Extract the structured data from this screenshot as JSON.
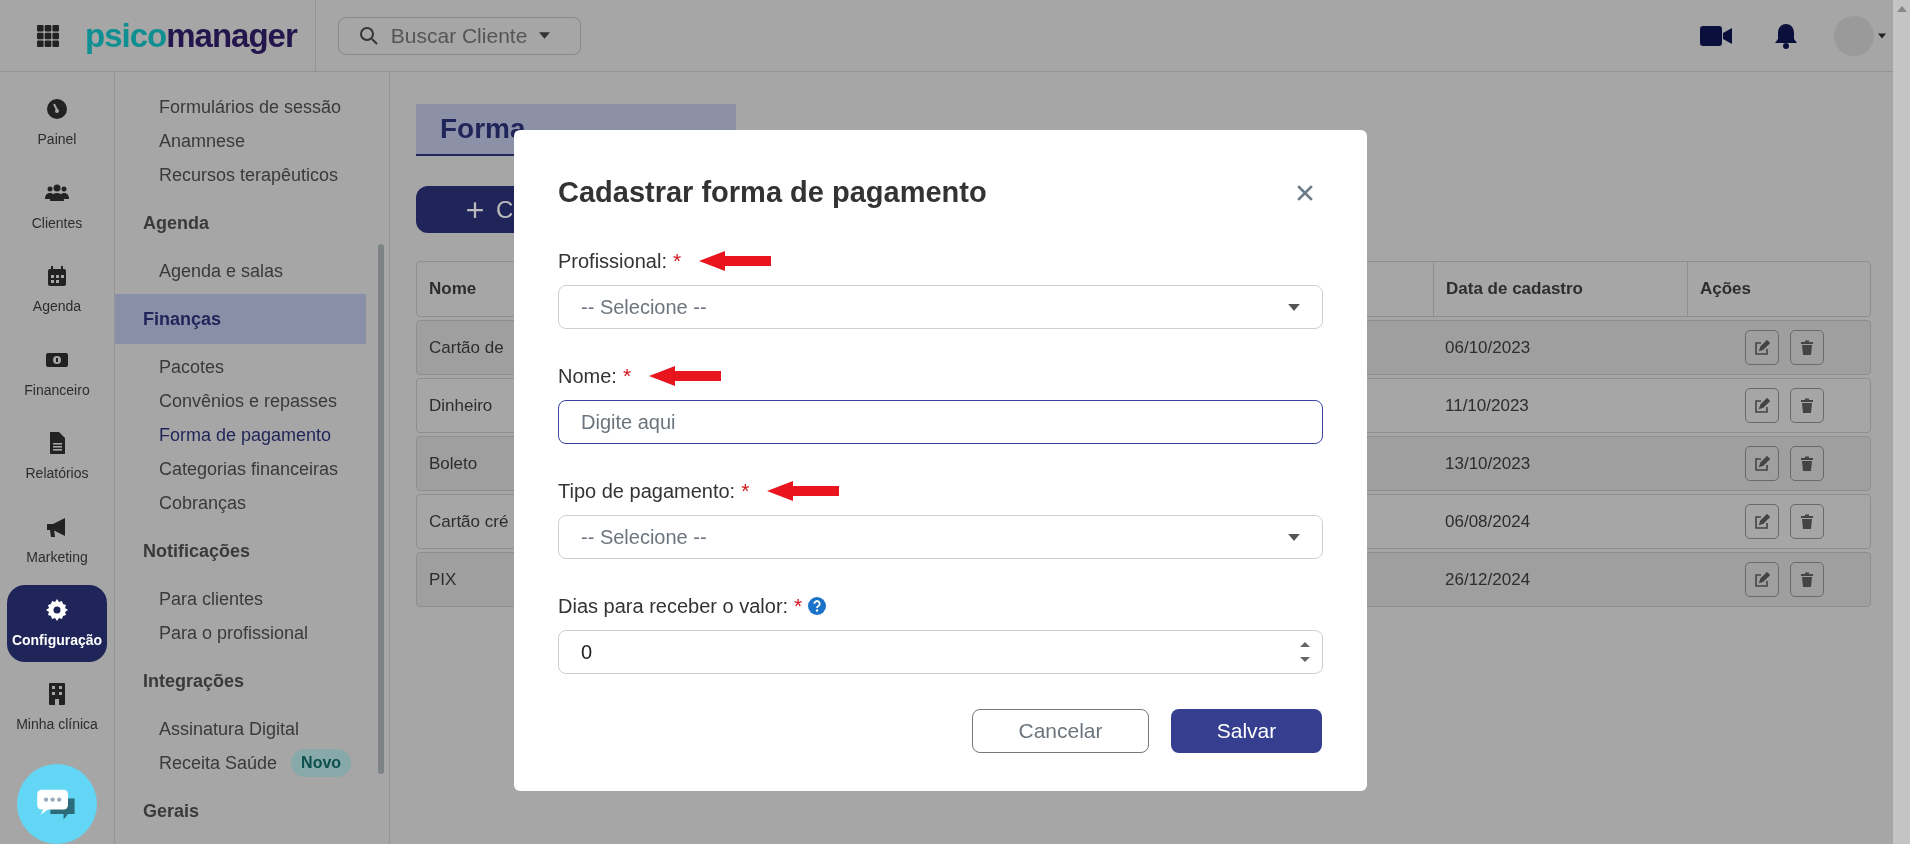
{
  "header": {
    "logo": {
      "prefix": "psico",
      "suffix": "manager"
    },
    "search": {
      "placeholder": "Buscar Cliente"
    }
  },
  "rail": [
    {
      "label": "Painel",
      "selected": false
    },
    {
      "label": "Clientes",
      "selected": false
    },
    {
      "label": "Agenda",
      "selected": false
    },
    {
      "label": "Financeiro",
      "selected": false
    },
    {
      "label": "Relatórios",
      "selected": false
    },
    {
      "label": "Marketing",
      "selected": false
    },
    {
      "label": "Configuração",
      "selected": true
    },
    {
      "label": "Minha clínica",
      "selected": false
    }
  ],
  "submenu": [
    {
      "items": [
        {
          "label": "Formulários de sessão",
          "selected": false
        },
        {
          "label": "Anamnese",
          "selected": false
        },
        {
          "label": "Recursos terapêuticos",
          "selected": false
        }
      ]
    },
    {
      "title": "Agenda",
      "selected": false,
      "items": [
        {
          "label": "Agenda e salas",
          "selected": false
        }
      ]
    },
    {
      "title": "Finanças",
      "selected": true,
      "items": [
        {
          "label": "Pacotes",
          "selected": false
        },
        {
          "label": "Convênios e repasses",
          "selected": false
        },
        {
          "label": "Forma de pagamento",
          "selected": true
        },
        {
          "label": "Categorias financeiras",
          "selected": false
        },
        {
          "label": "Cobranças",
          "selected": false
        }
      ]
    },
    {
      "title": "Notificações",
      "selected": false,
      "items": [
        {
          "label": "Para clientes",
          "selected": false
        },
        {
          "label": "Para o profissional",
          "selected": false
        }
      ]
    },
    {
      "title": "Integrações",
      "selected": false,
      "items": [
        {
          "label": "Assinatura Digital",
          "selected": false
        },
        {
          "label": "Receita Saúde",
          "selected": false,
          "badge": "Novo"
        }
      ]
    },
    {
      "title": "Gerais",
      "selected": false
    }
  ],
  "page": {
    "title": "Forma",
    "add_button": "C",
    "table": {
      "columns": [
        "Nome",
        "Data de cadastro",
        "Ações"
      ],
      "rows": [
        {
          "nome": "Cartão de",
          "data": "06/10/2023"
        },
        {
          "nome": "Dinheiro",
          "data": "11/10/2023"
        },
        {
          "nome": "Boleto",
          "data": "13/10/2023"
        },
        {
          "nome": "Cartão cré",
          "data": "06/08/2024"
        },
        {
          "nome": "PIX",
          "data": "26/12/2024"
        }
      ]
    }
  },
  "modal": {
    "title": "Cadastrar forma de pagamento",
    "fields": [
      {
        "kind": "select",
        "label": "Profissional:",
        "required_mark": "*",
        "annotated": true,
        "help": false,
        "placeholder": "-- Selecione --"
      },
      {
        "kind": "text",
        "label": "Nome:",
        "required_mark": "*",
        "annotated": true,
        "help": false,
        "placeholder": "Digite aqui",
        "focused": true
      },
      {
        "kind": "select",
        "label": "Tipo de pagamento:",
        "required_mark": "*",
        "annotated": true,
        "help": false,
        "placeholder": "-- Selecione --"
      },
      {
        "kind": "number",
        "label": "Dias para receber o valor:",
        "required_mark": "*",
        "annotated": false,
        "help": true,
        "value": "0"
      }
    ],
    "buttons": [
      {
        "label": "Cancelar",
        "kind": "secondary"
      },
      {
        "label": "Salvar",
        "kind": "primary"
      }
    ]
  }
}
